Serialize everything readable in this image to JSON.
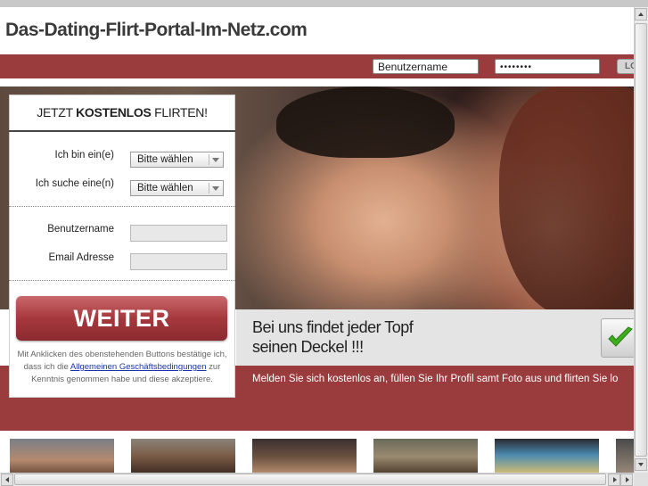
{
  "header": {
    "site_title": "Das-Dating-Flirt-Portal-Im-Netz.com"
  },
  "login": {
    "username_value": "Benutzername",
    "password_value": "••••••••",
    "button_label": "LO"
  },
  "form": {
    "heading_pre": "JETZT ",
    "heading_bold": "KOSTENLOS",
    "heading_post": " FLIRTEN!",
    "gender_label": "Ich bin ein(e)",
    "gender_select": "Bitte wählen",
    "seek_label": "Ich suche eine(n)",
    "seek_select": "Bitte wählen",
    "username_label": "Benutzername",
    "email_label": "Email Adresse",
    "submit_label": "WEITER",
    "terms_pre": "Mit Anklicken des obenstehenden Buttons bestätige ich, dass ich die ",
    "terms_link": "Allgemeinen Geschäftsbedingungen",
    "terms_post": " zur Kenntnis genommen habe und diese akzeptiere."
  },
  "promo": {
    "line1": "Bei uns findet jeder Topf",
    "line2": "seinen Deckel !!!",
    "subline": "Melden Sie sich kostenlos an, füllen Sie Ihr Profil samt Foto aus und flirten Sie lo"
  },
  "colors": {
    "brand_red": "#9a3b3e",
    "button_red": "#a5383d",
    "check_green": "#3cae1e"
  },
  "icons": {
    "checkmark": "check-icon",
    "select_arrow": "chevron-down-icon"
  }
}
